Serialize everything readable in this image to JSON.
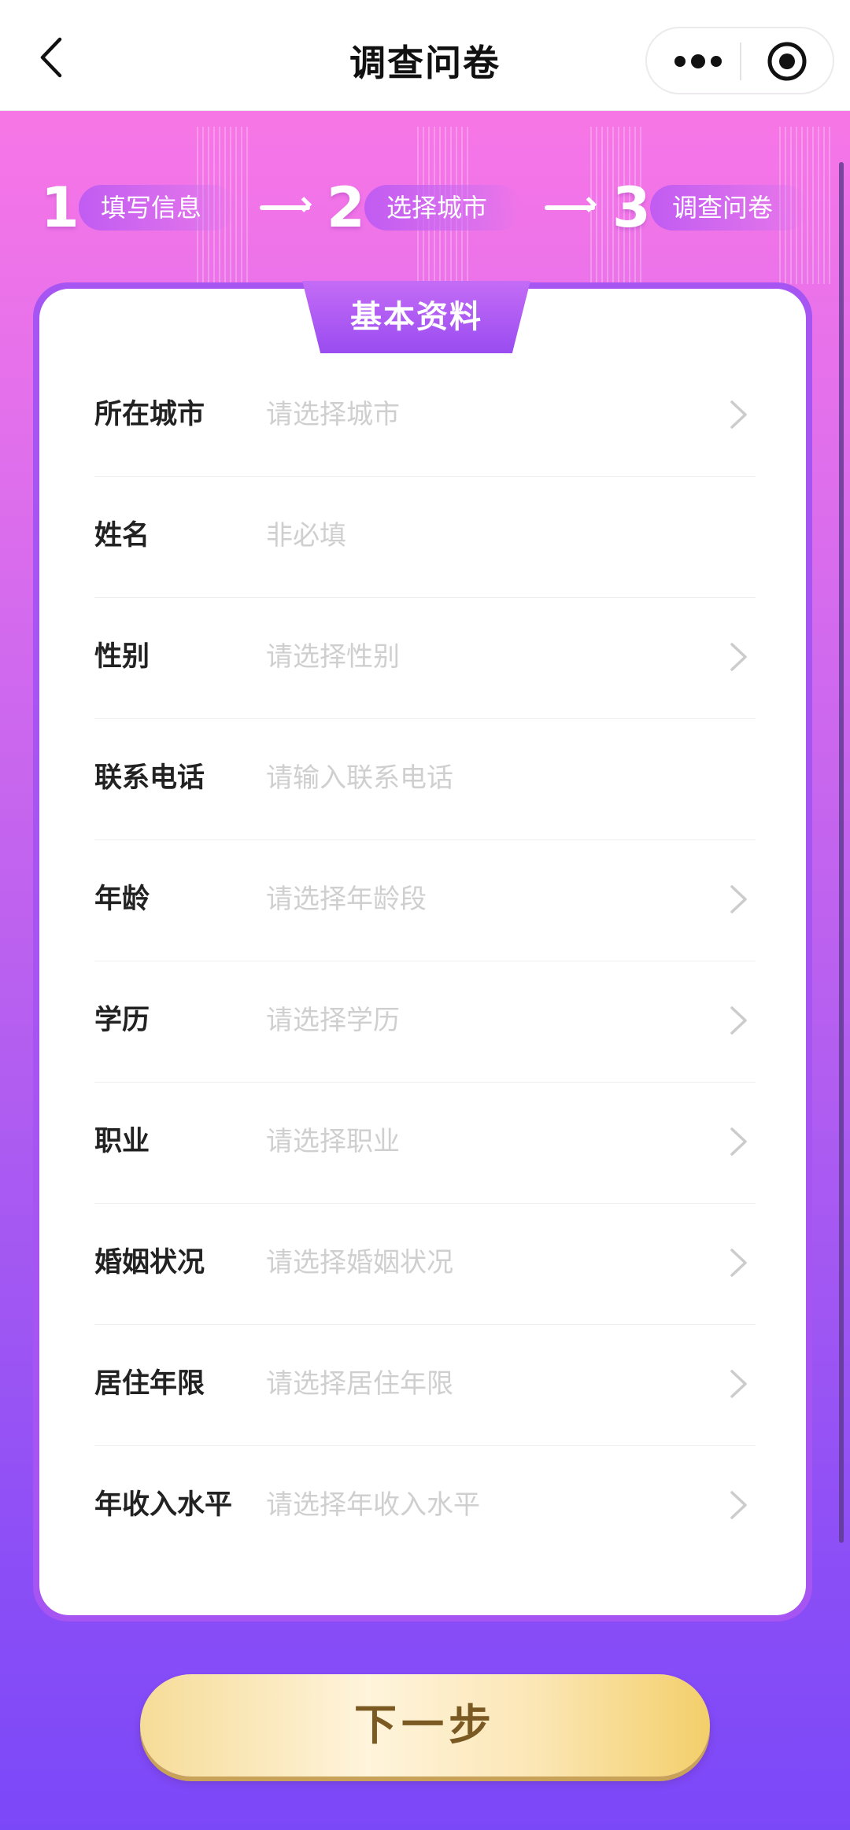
{
  "nav": {
    "title": "调查问卷",
    "back_icon": "chevron-left-icon",
    "more_icon": "more-dots-icon",
    "close_icon": "target-circle-icon"
  },
  "steps": [
    {
      "num": "1",
      "label": "填写信息"
    },
    {
      "num": "2",
      "label": "选择城市"
    },
    {
      "num": "3",
      "label": "调查问卷"
    }
  ],
  "card": {
    "title": "基本资料",
    "rows": [
      {
        "label": "所在城市",
        "placeholder": "请选择城市",
        "has_chevron": true
      },
      {
        "label": "姓名",
        "placeholder": "非必填",
        "has_chevron": false
      },
      {
        "label": "性别",
        "placeholder": "请选择性别",
        "has_chevron": true
      },
      {
        "label": "联系电话",
        "placeholder": "请输入联系电话",
        "has_chevron": false
      },
      {
        "label": "年龄",
        "placeholder": "请选择年龄段",
        "has_chevron": true
      },
      {
        "label": "学历",
        "placeholder": "请选择学历",
        "has_chevron": true
      },
      {
        "label": "职业",
        "placeholder": "请选择职业",
        "has_chevron": true
      },
      {
        "label": "婚姻状况",
        "placeholder": "请选择婚姻状况",
        "has_chevron": true
      },
      {
        "label": "居住年限",
        "placeholder": "请选择居住年限",
        "has_chevron": true
      },
      {
        "label": "年收入水平",
        "placeholder": "请选择年收入水平",
        "has_chevron": true
      }
    ]
  },
  "next_button": {
    "label": "下一步"
  },
  "colors": {
    "gradient_top": "#f776e6",
    "gradient_bottom": "#7b48f8",
    "card_border": "#a654f2",
    "button_gold": "#f3cf6a",
    "button_text": "#7a5a22"
  }
}
